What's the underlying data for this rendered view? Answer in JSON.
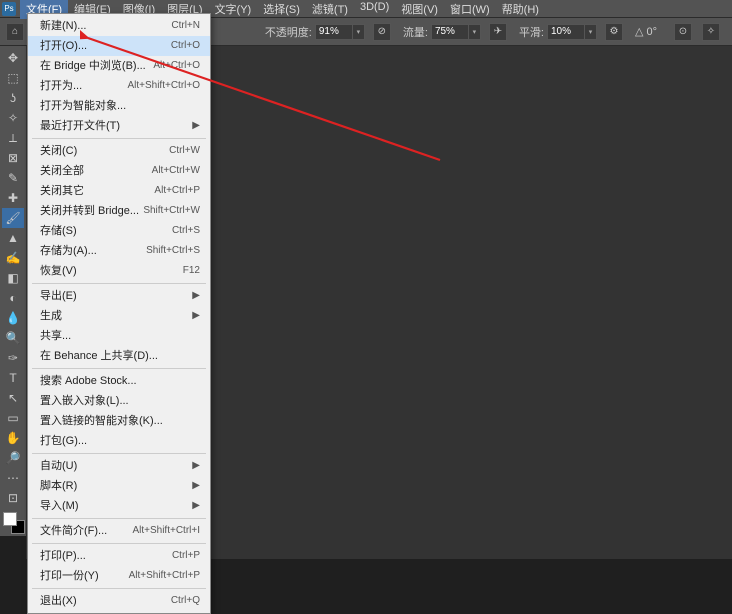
{
  "menubar": {
    "items": [
      "文件(F)",
      "编辑(E)",
      "图像(I)",
      "图层(L)",
      "文字(Y)",
      "选择(S)",
      "滤镜(T)",
      "3D(D)",
      "视图(V)",
      "窗口(W)",
      "帮助(H)"
    ],
    "active_index": 0
  },
  "options_bar": {
    "opacity_label": "不透明度:",
    "opacity_value": "91%",
    "flow_label": "流量:",
    "flow_value": "75%",
    "smoothing_label": "平滑:",
    "smoothing_value": "10%",
    "angle_icon": "△",
    "angle_value": "0°"
  },
  "toolbox": {
    "tools": [
      {
        "name": "move-tool",
        "glyph": "✥"
      },
      {
        "name": "marquee-tool",
        "glyph": "⬚"
      },
      {
        "name": "lasso-tool",
        "glyph": "ʖ"
      },
      {
        "name": "wand-tool",
        "glyph": "✧"
      },
      {
        "name": "crop-tool",
        "glyph": "⟂"
      },
      {
        "name": "frame-tool",
        "glyph": "⊠"
      },
      {
        "name": "eyedropper-tool",
        "glyph": "✎"
      },
      {
        "name": "healing-tool",
        "glyph": "✚"
      },
      {
        "name": "brush-tool",
        "glyph": "🖌"
      },
      {
        "name": "stamp-tool",
        "glyph": "▲"
      },
      {
        "name": "history-brush-tool",
        "glyph": "✍"
      },
      {
        "name": "eraser-tool",
        "glyph": "◧"
      },
      {
        "name": "gradient-tool",
        "glyph": "◐"
      },
      {
        "name": "blur-tool",
        "glyph": "💧"
      },
      {
        "name": "dodge-tool",
        "glyph": "🔍"
      },
      {
        "name": "pen-tool",
        "glyph": "✑"
      },
      {
        "name": "type-tool",
        "glyph": "T"
      },
      {
        "name": "path-tool",
        "glyph": "↖"
      },
      {
        "name": "shape-tool",
        "glyph": "▭"
      },
      {
        "name": "hand-tool",
        "glyph": "✋"
      },
      {
        "name": "zoom-tool",
        "glyph": "🔎"
      },
      {
        "name": "more-tool",
        "glyph": "⋯"
      },
      {
        "name": "edit-toolbar",
        "glyph": "⊡"
      }
    ],
    "active_index": 8
  },
  "file_menu": {
    "groups": [
      [
        {
          "label": "新建(N)...",
          "shortcut": "Ctrl+N",
          "sub": false
        },
        {
          "label": "打开(O)...",
          "shortcut": "Ctrl+O",
          "sub": false,
          "highlight": true
        },
        {
          "label": "在 Bridge 中浏览(B)...",
          "shortcut": "Alt+Ctrl+O",
          "sub": false
        },
        {
          "label": "打开为...",
          "shortcut": "Alt+Shift+Ctrl+O",
          "sub": false
        },
        {
          "label": "打开为智能对象...",
          "shortcut": "",
          "sub": false
        },
        {
          "label": "最近打开文件(T)",
          "shortcut": "",
          "sub": true
        }
      ],
      [
        {
          "label": "关闭(C)",
          "shortcut": "Ctrl+W",
          "sub": false
        },
        {
          "label": "关闭全部",
          "shortcut": "Alt+Ctrl+W",
          "sub": false
        },
        {
          "label": "关闭其它",
          "shortcut": "Alt+Ctrl+P",
          "sub": false
        },
        {
          "label": "关闭并转到 Bridge...",
          "shortcut": "Shift+Ctrl+W",
          "sub": false
        },
        {
          "label": "存储(S)",
          "shortcut": "Ctrl+S",
          "sub": false
        },
        {
          "label": "存储为(A)...",
          "shortcut": "Shift+Ctrl+S",
          "sub": false
        },
        {
          "label": "恢复(V)",
          "shortcut": "F12",
          "sub": false
        }
      ],
      [
        {
          "label": "导出(E)",
          "shortcut": "",
          "sub": true
        },
        {
          "label": "生成",
          "shortcut": "",
          "sub": true
        },
        {
          "label": "共享...",
          "shortcut": "",
          "sub": false
        },
        {
          "label": "在 Behance 上共享(D)...",
          "shortcut": "",
          "sub": false
        }
      ],
      [
        {
          "label": "搜索 Adobe Stock...",
          "shortcut": "",
          "sub": false
        },
        {
          "label": "置入嵌入对象(L)...",
          "shortcut": "",
          "sub": false
        },
        {
          "label": "置入链接的智能对象(K)...",
          "shortcut": "",
          "sub": false
        },
        {
          "label": "打包(G)...",
          "shortcut": "",
          "sub": false
        }
      ],
      [
        {
          "label": "自动(U)",
          "shortcut": "",
          "sub": true
        },
        {
          "label": "脚本(R)",
          "shortcut": "",
          "sub": true
        },
        {
          "label": "导入(M)",
          "shortcut": "",
          "sub": true
        }
      ],
      [
        {
          "label": "文件简介(F)...",
          "shortcut": "Alt+Shift+Ctrl+I",
          "sub": false
        }
      ],
      [
        {
          "label": "打印(P)...",
          "shortcut": "Ctrl+P",
          "sub": false
        },
        {
          "label": "打印一份(Y)",
          "shortcut": "Alt+Shift+Ctrl+P",
          "sub": false
        }
      ],
      [
        {
          "label": "退出(X)",
          "shortcut": "Ctrl+Q",
          "sub": false
        }
      ]
    ]
  }
}
